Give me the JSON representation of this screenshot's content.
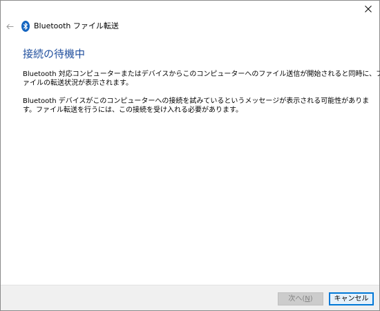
{
  "window": {
    "title": "Bluetooth ファイル転送"
  },
  "icons": {
    "close": "close-icon",
    "back": "back-arrow-icon",
    "bluetooth": "bluetooth-icon"
  },
  "colors": {
    "heading": "#1f4e9d",
    "bluetooth": "#1565c0",
    "footer_bg": "#f0f0f0",
    "primary_border": "#0078d7"
  },
  "main": {
    "heading": "接続の待機中",
    "para1_line1": "Bluetooth 対応コンピューターまたはデバイスからこのコンピューターへのファイル送信が開始されると同時に、フ",
    "para1_line2": "ァイルの転送状況が表示されます。",
    "para2_line1": "Bluetooth デバイスがこのコンピューターへの接続を試みているというメッセージが表示される可能性がありま",
    "para2_line2": "す。ファイル転送を行うには、この接続を受け入れる必要があります。"
  },
  "footer": {
    "next_label_prefix": "次へ(",
    "next_label_key": "N",
    "next_label_suffix": ")",
    "next_enabled": false,
    "cancel_label": "キャンセル"
  }
}
